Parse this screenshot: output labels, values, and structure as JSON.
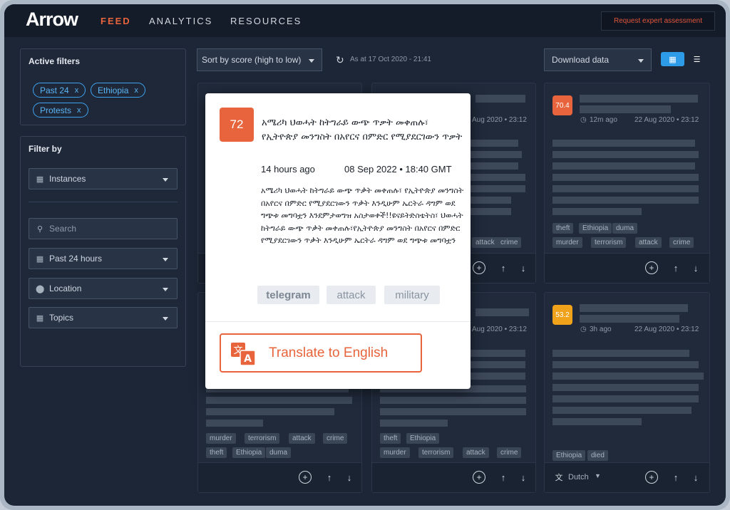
{
  "app": {
    "logo": "Arrow"
  },
  "nav": {
    "items": [
      "FEED",
      "ANALYTICS",
      "RESOURCES"
    ],
    "active": "FEED"
  },
  "header": {
    "request_button": "Request expert assessment"
  },
  "active_filters": {
    "title": "Active filters",
    "chips": [
      "Past 24",
      "Ethiopia",
      "Protests"
    ],
    "remove_symbol": "x"
  },
  "filter_by": {
    "title": "Filter by",
    "instances": "Instances",
    "search_placeholder": "Search",
    "time": "Past 24 hours",
    "location": "Location",
    "topics": "Topics"
  },
  "toolbar": {
    "sort": "Sort by score (high to low)",
    "as_at": "As at 17 Oct 2020 - 21:41",
    "download": "Download data"
  },
  "cards": [
    {
      "date": "Aug 2020 • 23:12",
      "tags_row1": [],
      "tags_row2": [
        "attack",
        "crime"
      ]
    },
    {
      "score": "70.4",
      "score_color": "#e8643c",
      "ago": "12m ago",
      "date": "22 Aug 2020 • 23:12",
      "tags_row1": [
        "theft",
        "Ethiopia",
        "duma"
      ],
      "tags_row2": [
        "murder",
        "terrorism",
        "attack",
        "crime"
      ]
    },
    {
      "tags_row1": [
        "murder",
        "terrorism",
        "attack",
        "crime"
      ],
      "tags_row2": [
        "theft",
        "Ethiopia",
        "duma"
      ]
    },
    {
      "date": "Aug 2020 • 23:12",
      "tags_row1": [
        "theft",
        "Ethiopia"
      ],
      "tags_row2": [
        "murder",
        "terrorism",
        "attack",
        "crime"
      ]
    },
    {
      "score": "53.2",
      "score_color": "#f0a21b",
      "ago": "3h ago",
      "date": "22 Aug 2020 • 23:12",
      "tags_row1": [
        "Ethiopia",
        "died"
      ],
      "language": "Dutch"
    }
  ],
  "modal": {
    "score": "72",
    "title": "አሜሪካ ህወሓት ከትግራይ ውጭ ጥቃት መቀጠሉ፣ የኢትዮጵያ መንግስት በአየርና በምድር የሚያደርገውን ጥቃት",
    "ago": "14 hours ago",
    "date": "08 Sep 2022 • 18:40 GMT",
    "body": "አሜሪካ ህወሓት ከትግራይ ውጭ ጥቃት መቀጠሉ፣ የኢትዮጵያ መንግስት በአየርና በምድር የሚያደርገውን ጥቃት እንዲሁም ኤርትራ ዳግም ወደ ግጭቱ መግባቷን እንደምታወግዝ አስታወቀች!!ዩናይትድስቴትስ፣ ህወሓት ከትግራይ ውጭ ጥቃት መቀጠሉ፣የኢትዮጵያ መንግስት በአየርና በምድር የሚያደርገውን ጥቃት እንዲሁም ኤርትራ ዳግም ወደ ግጭቱ መግባቷን",
    "tags": [
      "telegram",
      "attack",
      "military"
    ],
    "translate": "Translate to English"
  },
  "colors": {
    "accent": "#e8643c",
    "chip": "#3ea3ef",
    "view_active": "#2d9be8"
  },
  "icons": [
    "calendar-icon",
    "search-icon",
    "location-pin-icon",
    "refresh-icon",
    "grid-view-icon",
    "list-view-icon",
    "add-circle-icon",
    "arrow-up-icon",
    "arrow-down-icon",
    "translate-icon",
    "clock-icon"
  ]
}
